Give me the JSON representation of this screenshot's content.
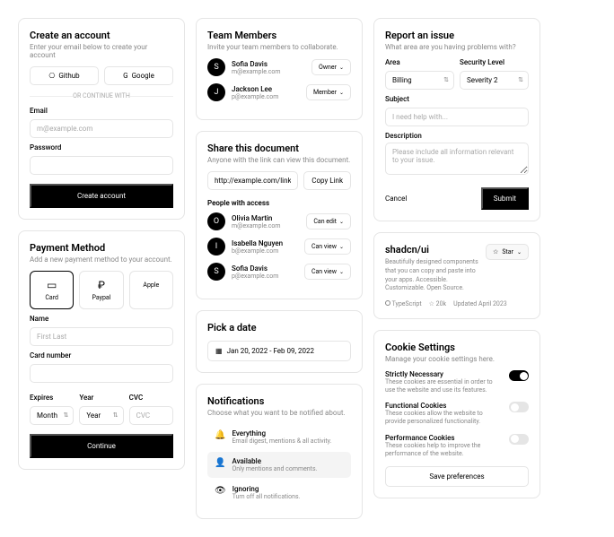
{
  "account": {
    "title": "Create an account",
    "sub": "Enter your email below to create your account",
    "github": "Github",
    "google": "Google",
    "divider": "OR CONTINUE WITH",
    "email_label": "Email",
    "email_ph": "m@example.com",
    "pwd_label": "Password",
    "submit": "Create account"
  },
  "payment": {
    "title": "Payment Method",
    "sub": "Add a new payment method to your account.",
    "opts": [
      "Card",
      "Paypal",
      "Apple"
    ],
    "name_label": "Name",
    "name_ph": "First Last",
    "card_label": "Card number",
    "exp_label": "Expires",
    "exp_ph": "Month",
    "year_label": "Year",
    "year_ph": "Year",
    "cvc_label": "CVC",
    "cvc_ph": "CVC",
    "submit": "Continue"
  },
  "team": {
    "title": "Team Members",
    "sub": "Invite your team members to collaborate.",
    "members": [
      {
        "name": "Sofia Davis",
        "email": "m@example.com",
        "role": "Owner"
      },
      {
        "name": "Jackson Lee",
        "email": "p@example.com",
        "role": "Member"
      }
    ]
  },
  "share": {
    "title": "Share this document",
    "sub": "Anyone with the link can view this document.",
    "link": "http://example.com/link/to/document",
    "copy": "Copy Link",
    "access_title": "People with access",
    "people": [
      {
        "name": "Olivia Martin",
        "email": "m@example.com",
        "perm": "Can edit"
      },
      {
        "name": "Isabella Nguyen",
        "email": "b@example.com",
        "perm": "Can view"
      },
      {
        "name": "Sofia Davis",
        "email": "p@example.com",
        "perm": "Can view"
      }
    ]
  },
  "date": {
    "title": "Pick a date",
    "range": "Jan 20, 2022 - Feb 09, 2022"
  },
  "notif": {
    "title": "Notifications",
    "sub": "Choose what you want to be notified about.",
    "items": [
      {
        "t": "Everything",
        "d": "Email digest, mentions & all activity."
      },
      {
        "t": "Available",
        "d": "Only mentions and comments."
      },
      {
        "t": "Ignoring",
        "d": "Turn off all notifications."
      }
    ]
  },
  "issue": {
    "title": "Report an issue",
    "sub": "What area are you having problems with?",
    "area_label": "Area",
    "area": "Billing",
    "sec_label": "Security Level",
    "sec": "Severity 2",
    "subj_label": "Subject",
    "subj_ph": "I need help with...",
    "desc_label": "Description",
    "desc_ph": "Please include all information relevant to your issue.",
    "cancel": "Cancel",
    "submit": "Submit"
  },
  "repo": {
    "name": "shadcn/ui",
    "desc": "Beautifully designed components that you can copy and paste into your apps. Accessible. Customizable. Open Source.",
    "star": "Star",
    "lang": "TypeScript",
    "stars": "20k",
    "updated": "Updated April 2023"
  },
  "cookies": {
    "title": "Cookie Settings",
    "sub": "Manage your cookie settings here.",
    "items": [
      {
        "t": "Strictly Necessary",
        "d": "These cookies are essential in order to use the website and use its features.",
        "on": true
      },
      {
        "t": "Functional Cookies",
        "d": "These cookies allow the website to provide personalized functionality.",
        "on": false
      },
      {
        "t": "Performance Cookies",
        "d": "These cookies help to improve the performance of the website.",
        "on": false
      }
    ],
    "save": "Save preferences"
  }
}
